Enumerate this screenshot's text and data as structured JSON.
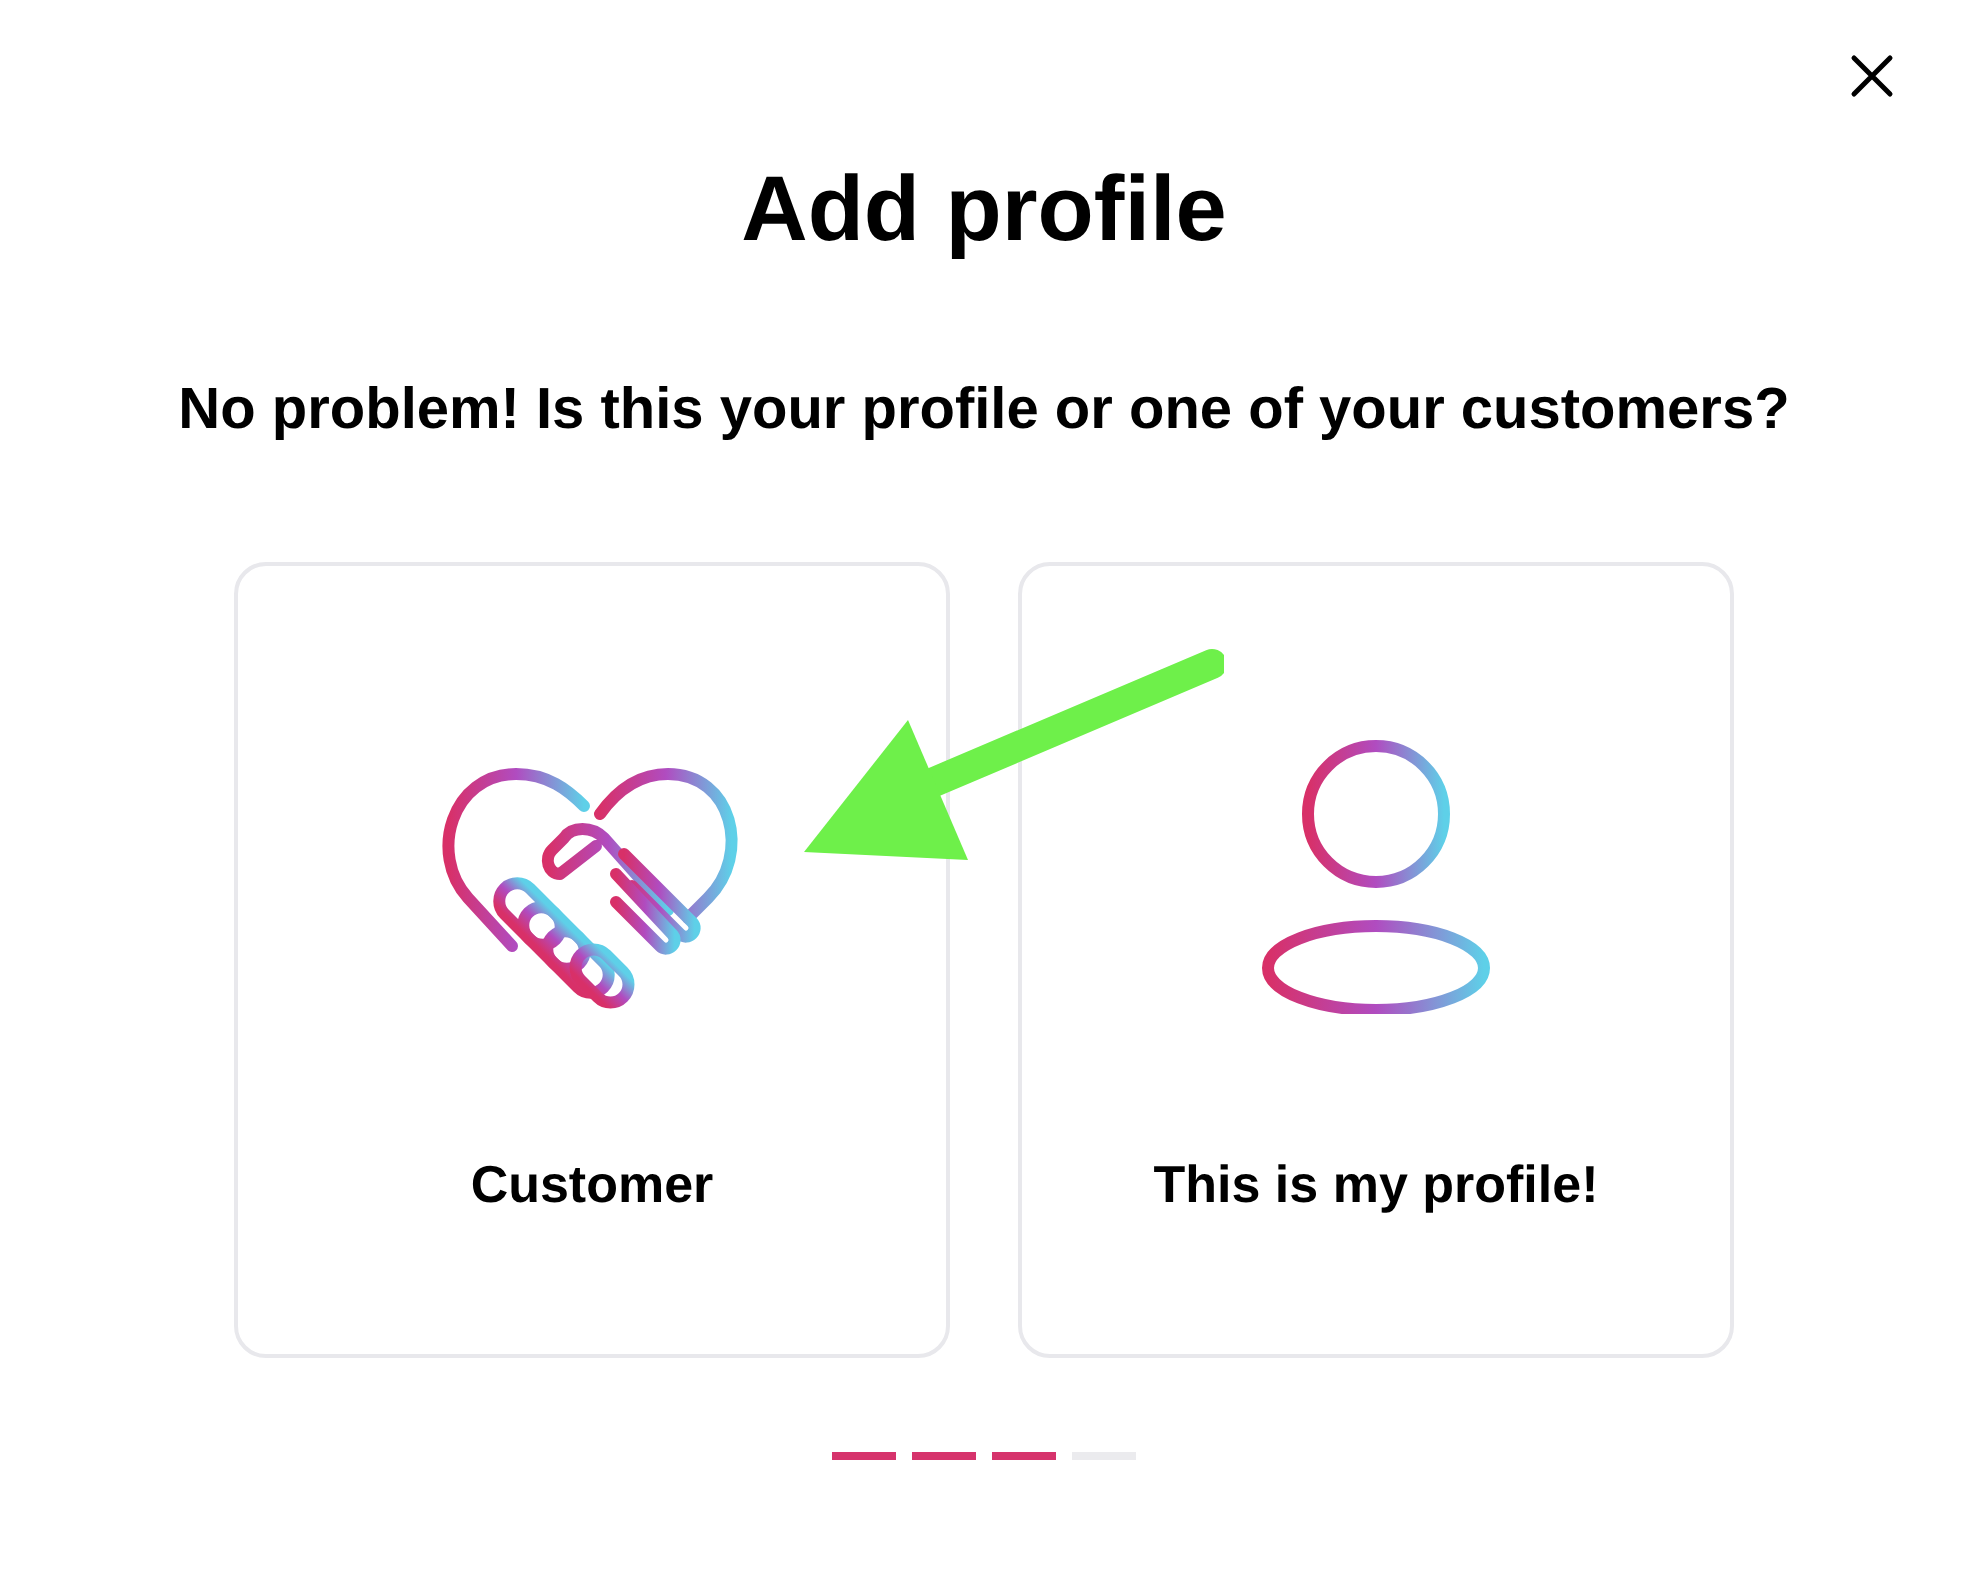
{
  "dialog": {
    "title": "Add profile",
    "question": "No problem! Is this your profile or one of your customers?"
  },
  "options": [
    {
      "kind": "handshake",
      "label": "Customer"
    },
    {
      "kind": "person",
      "label": "This is my profile!"
    }
  ],
  "progress": [
    {
      "done": true
    },
    {
      "done": true
    },
    {
      "done": true
    },
    {
      "done": false
    }
  ],
  "annotation": {
    "kind": "arrow"
  }
}
